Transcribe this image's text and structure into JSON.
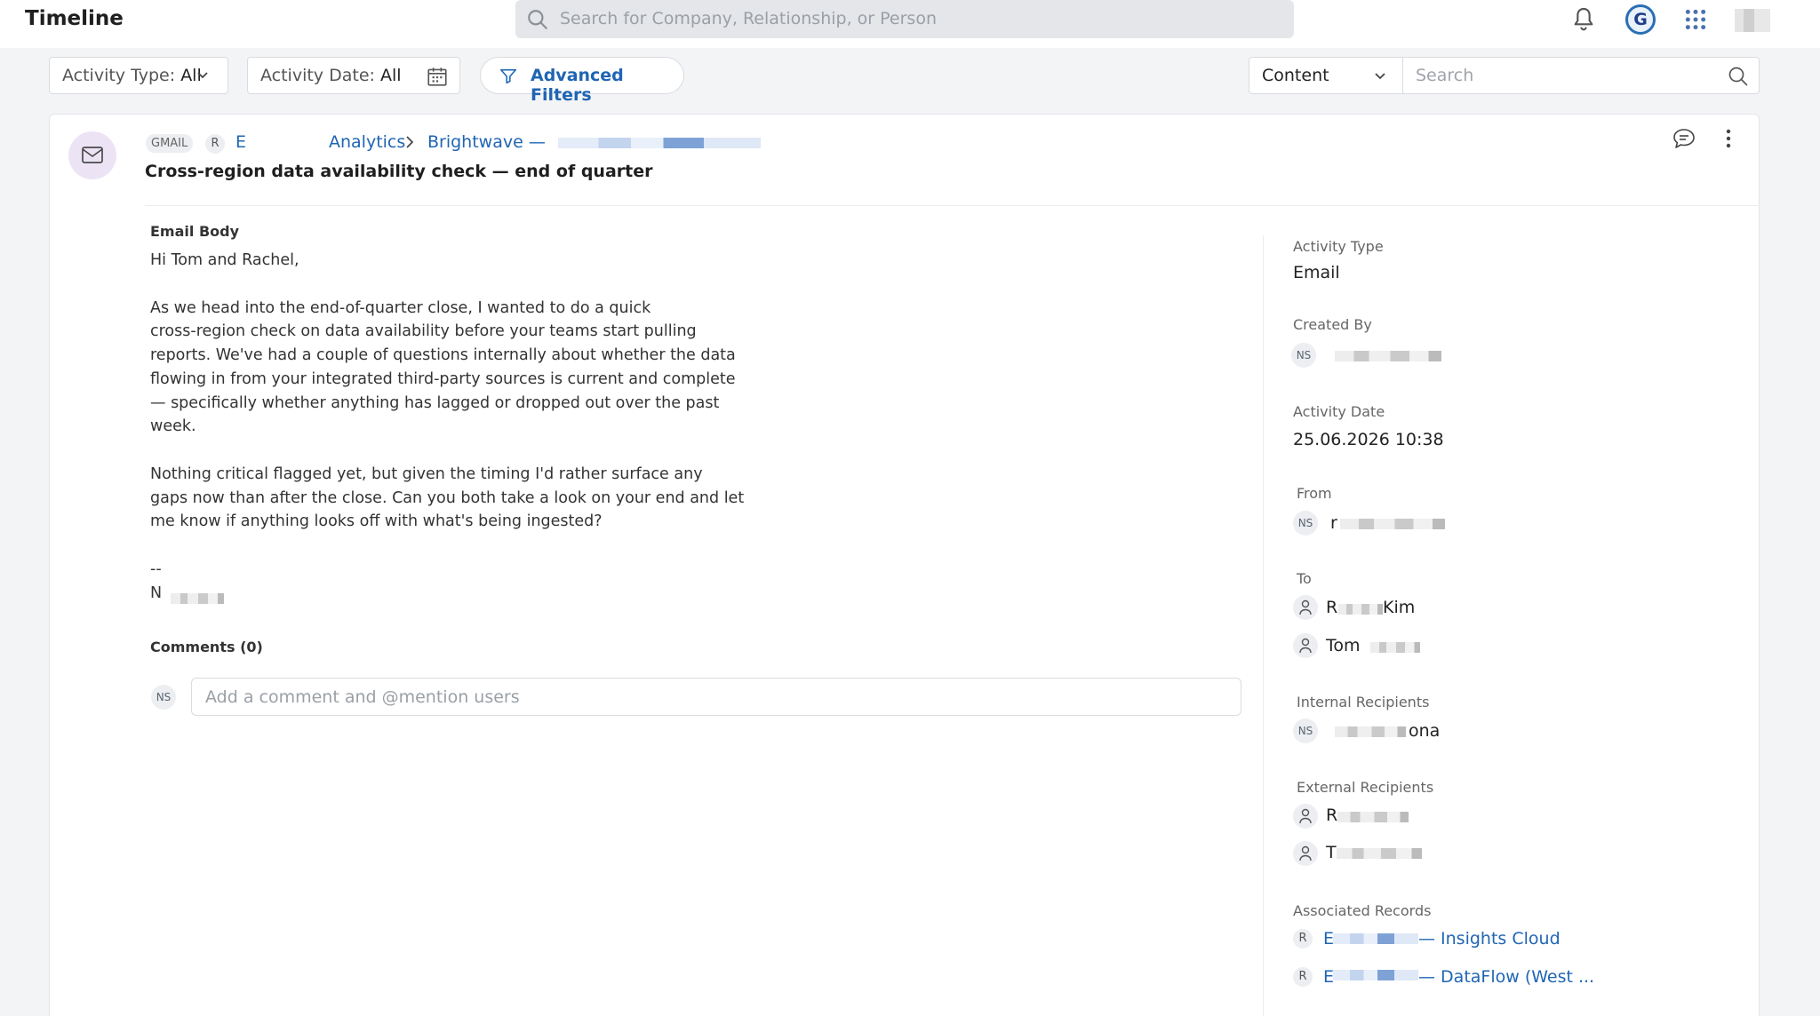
{
  "header": {
    "title": "Timeline",
    "search_placeholder": "Search for Company, Relationship, or Person",
    "logo_letter": "G"
  },
  "filters": {
    "activity_type_label": "Activity Type:",
    "activity_type_value": "All",
    "activity_date_label": "Activity Date:",
    "activity_date_value": "All",
    "advanced_filters": "Advanced Filters",
    "content_select": "Content",
    "search_placeholder": "Search"
  },
  "activity": {
    "source_badge": "GMAIL",
    "record_badge": "R",
    "breadcrumb_first": "E",
    "breadcrumb_analytics": "Analytics",
    "breadcrumb_brightwave": "Brightwave —",
    "subject": "Cross-region data availability check — end of quarter",
    "email_body_label": "Email Body",
    "body_lines": [
      "Hi Tom and Rachel,",
      "As we head into the end-of-quarter close, I wanted to do a quick",
      "cross-region check on data availability before your teams start pulling",
      "reports. We've had a couple of questions internally about whether the data",
      "flowing in from your integrated third-party sources is current and complete",
      "— specifically whether anything has lagged or dropped out over the past",
      "week.",
      "Nothing critical flagged yet, but given the timing I'd rather surface any",
      "gaps now than after the close. Can you both take a look on your end and let",
      "me know if anything looks off with what's being ingested?",
      "--",
      "N"
    ],
    "comments_label": "Comments (0)",
    "comment_avatar": "NS",
    "comment_placeholder": "Add a comment and @mention users"
  },
  "details": {
    "activity_type_label": "Activity Type",
    "activity_type_value": "Email",
    "created_by_label": "Created By",
    "created_by_avatar": "NS",
    "activity_date_label": "Activity Date",
    "activity_date_value": "25.06.2026 10:38",
    "from_label": "From",
    "from_avatar": "NS",
    "from_value": "r",
    "to_label": "To",
    "to_1_first": "R",
    "to_1_last": "Kim",
    "to_2_first": "Tom",
    "internal_label": "Internal Recipients",
    "internal_avatar": "NS",
    "internal_suffix": "ona",
    "external_label": "External Recipients",
    "external_1": "R",
    "external_2": "T",
    "associated_label": "Associated Records",
    "assoc_badge": "R",
    "assoc_1_prefix": "E",
    "assoc_1_suffix": "— Insights Cloud",
    "assoc_2_prefix": "E",
    "assoc_2_suffix": "— DataFlow (West ..."
  }
}
